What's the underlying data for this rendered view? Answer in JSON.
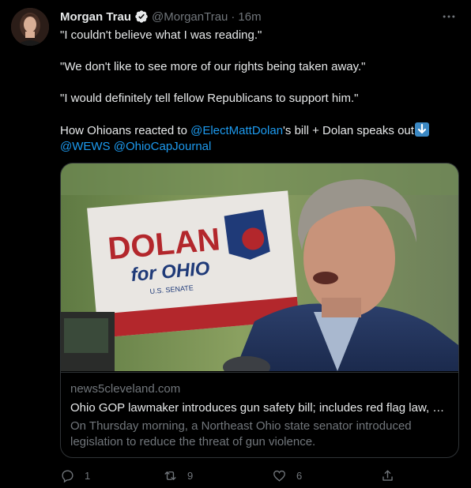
{
  "tweet": {
    "author_name": "Morgan Trau",
    "handle": "@MorganTrau",
    "separator": "·",
    "time": "16m",
    "text_line_1": "\"I couldn't believe what I was reading.\"",
    "text_line_2": "\"We don't like to see more of our rights being taken away.\"",
    "text_line_3": "\"I would definitely tell fellow Republicans to support him.\"",
    "text_line_4_prefix": "How Ohioans reacted to ",
    "mention_1": "@ElectMattDolan",
    "text_line_4_suffix": "'s bill + Dolan speaks out",
    "mention_2": "@WEWS",
    "mention_3": "@OhioCapJournal"
  },
  "card": {
    "image_sign_line_1": "DOLAN",
    "image_sign_line_2": "for OHIO",
    "image_sign_line_3": "U.S. SENATE",
    "domain": "news5cleveland.com",
    "title": "Ohio GOP lawmaker introduces gun safety bill; includes red flag law, e...",
    "description": "On Thursday morning, a Northeast Ohio state senator introduced legislation to reduce the threat of gun violence."
  },
  "actions": {
    "replies": "1",
    "retweets": "9",
    "likes": "6"
  },
  "icons": {
    "verified": "verified-badge-icon",
    "more": "more-horizontal-icon",
    "reply": "reply-icon",
    "retweet": "retweet-icon",
    "like": "heart-icon",
    "share": "share-icon",
    "emoji": "down-arrow-emoji"
  },
  "colors": {
    "background": "#000000",
    "text": "#e7e9ea",
    "muted": "#71767b",
    "link": "#1d9bf0",
    "border": "#2f3336"
  }
}
